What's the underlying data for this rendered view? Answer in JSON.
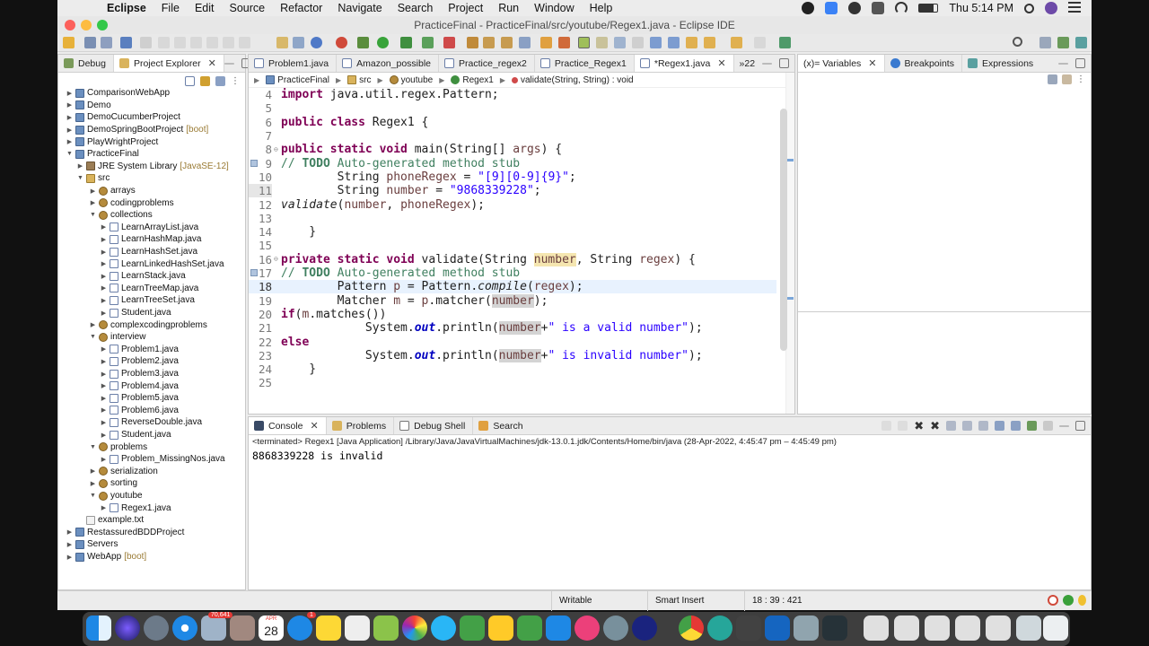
{
  "menubar": {
    "app": "Eclipse",
    "items": [
      "File",
      "Edit",
      "Source",
      "Refactor",
      "Navigate",
      "Search",
      "Project",
      "Run",
      "Window",
      "Help"
    ],
    "clock": "Thu 5:14 PM"
  },
  "window": {
    "title": "PracticeFinal - PracticeFinal/src/youtube/Regex1.java - Eclipse IDE"
  },
  "explorer": {
    "tabs": [
      {
        "label": "Debug"
      },
      {
        "label": "Project Explorer",
        "close": "✕"
      }
    ],
    "tree": [
      {
        "label": "ComparisonWebApp",
        "kind": "proj",
        "depth": 0,
        "twisty": "▶"
      },
      {
        "label": "Demo",
        "kind": "proj",
        "depth": 0,
        "twisty": "▶"
      },
      {
        "label": "DemoCucumberProject",
        "kind": "proj",
        "depth": 0,
        "twisty": "▶"
      },
      {
        "label": "DemoSpringBootProject",
        "kind": "proj",
        "depth": 0,
        "twisty": "▶",
        "deco": "[boot]"
      },
      {
        "label": "PlayWrightProject",
        "kind": "proj",
        "depth": 0,
        "twisty": "▶"
      },
      {
        "label": "PracticeFinal",
        "kind": "proj",
        "depth": 0,
        "twisty": "▼"
      },
      {
        "label": "JRE System Library",
        "kind": "jre",
        "depth": 1,
        "twisty": "▶",
        "deco": "[JavaSE-12]"
      },
      {
        "label": "src",
        "kind": "src",
        "depth": 1,
        "twisty": "▼"
      },
      {
        "label": "arrays",
        "kind": "pkg",
        "depth": 2,
        "twisty": "▶"
      },
      {
        "label": "codingproblems",
        "kind": "pkg",
        "depth": 2,
        "twisty": "▶"
      },
      {
        "label": "collections",
        "kind": "pkg",
        "depth": 2,
        "twisty": "▼"
      },
      {
        "label": "LearnArrayList.java",
        "kind": "java",
        "depth": 3,
        "twisty": "▶"
      },
      {
        "label": "LearnHashMap.java",
        "kind": "java",
        "depth": 3,
        "twisty": "▶"
      },
      {
        "label": "LearnHashSet.java",
        "kind": "java",
        "depth": 3,
        "twisty": "▶"
      },
      {
        "label": "LearnLinkedHashSet.java",
        "kind": "java",
        "depth": 3,
        "twisty": "▶"
      },
      {
        "label": "LearnStack.java",
        "kind": "java",
        "depth": 3,
        "twisty": "▶"
      },
      {
        "label": "LearnTreeMap.java",
        "kind": "java",
        "depth": 3,
        "twisty": "▶"
      },
      {
        "label": "LearnTreeSet.java",
        "kind": "java",
        "depth": 3,
        "twisty": "▶"
      },
      {
        "label": "Student.java",
        "kind": "java",
        "depth": 3,
        "twisty": "▶"
      },
      {
        "label": "complexcodingproblems",
        "kind": "pkg",
        "depth": 2,
        "twisty": "▶"
      },
      {
        "label": "interview",
        "kind": "pkg",
        "depth": 2,
        "twisty": "▼"
      },
      {
        "label": "Problem1.java",
        "kind": "java",
        "depth": 3,
        "twisty": "▶"
      },
      {
        "label": "Problem2.java",
        "kind": "java",
        "depth": 3,
        "twisty": "▶"
      },
      {
        "label": "Problem3.java",
        "kind": "java",
        "depth": 3,
        "twisty": "▶"
      },
      {
        "label": "Problem4.java",
        "kind": "java",
        "depth": 3,
        "twisty": "▶"
      },
      {
        "label": "Problem5.java",
        "kind": "java",
        "depth": 3,
        "twisty": "▶"
      },
      {
        "label": "Problem6.java",
        "kind": "java",
        "depth": 3,
        "twisty": "▶"
      },
      {
        "label": "ReverseDouble.java",
        "kind": "java",
        "depth": 3,
        "twisty": "▶"
      },
      {
        "label": "Student.java",
        "kind": "java",
        "depth": 3,
        "twisty": "▶"
      },
      {
        "label": "problems",
        "kind": "pkg",
        "depth": 2,
        "twisty": "▼"
      },
      {
        "label": "Problem_MissingNos.java",
        "kind": "java",
        "depth": 3,
        "twisty": "▶"
      },
      {
        "label": "serialization",
        "kind": "pkg",
        "depth": 2,
        "twisty": "▶"
      },
      {
        "label": "sorting",
        "kind": "pkg",
        "depth": 2,
        "twisty": "▶"
      },
      {
        "label": "youtube",
        "kind": "pkg",
        "depth": 2,
        "twisty": "▼"
      },
      {
        "label": "Regex1.java",
        "kind": "java",
        "depth": 3,
        "twisty": "▶"
      },
      {
        "label": "example.txt",
        "kind": "txt",
        "depth": 1,
        "twisty": ""
      },
      {
        "label": "RestassuredBDDProject",
        "kind": "proj",
        "depth": 0,
        "twisty": "▶"
      },
      {
        "label": "Servers",
        "kind": "proj",
        "depth": 0,
        "twisty": "▶"
      },
      {
        "label": "WebApp",
        "kind": "proj",
        "depth": 0,
        "twisty": "▶",
        "deco": "[boot]"
      }
    ]
  },
  "editor": {
    "tabs": [
      {
        "label": "Problem1.java"
      },
      {
        "label": "Amazon_possible"
      },
      {
        "label": "Practice_regex2"
      },
      {
        "label": "Practice_Regex1"
      },
      {
        "label": "*Regex1.java",
        "active": true,
        "close": "✕"
      },
      {
        "label": "»22"
      }
    ],
    "breadcrumb": [
      "PracticeFinal",
      "src",
      "youtube",
      "Regex1",
      "validate(String, String) : void"
    ],
    "current_line": "11",
    "lines": [
      "4",
      "5",
      "6",
      "7",
      "8",
      "9",
      "10",
      "11",
      "12",
      "13",
      "14",
      "15",
      "16",
      "17",
      "18",
      "19",
      "20",
      "21",
      "22",
      "23",
      "24",
      "25"
    ]
  },
  "vars": {
    "tabs": [
      {
        "label": "(x)= Variables",
        "close": "✕"
      },
      {
        "label": "Breakpoints"
      },
      {
        "label": "Expressions"
      }
    ]
  },
  "console": {
    "tabs": [
      {
        "label": "Console",
        "close": "✕"
      },
      {
        "label": "Problems"
      },
      {
        "label": "Debug Shell"
      },
      {
        "label": "Search"
      }
    ],
    "info": "<terminated> Regex1 [Java Application] /Library/Java/JavaVirtualMachines/jdk-13.0.1.jdk/Contents/Home/bin/java  (28-Apr-2022, 4:45:47 pm – 4:45:49 pm)",
    "output": "8868339228 is invalid"
  },
  "status": {
    "mode": "Writable",
    "insert": "Smart Insert",
    "position": "18 : 39 : 421"
  },
  "dock": {
    "badge_mail": "70,641",
    "calendar_month": "APR",
    "calendar_day": "28",
    "badge_appstore": "1"
  },
  "colors": {
    "keyword": "#7f0055",
    "comment": "#3f7f5f",
    "string": "#2a00ff",
    "static_field": "#0000c0",
    "current_line": "#e8f2fe"
  }
}
